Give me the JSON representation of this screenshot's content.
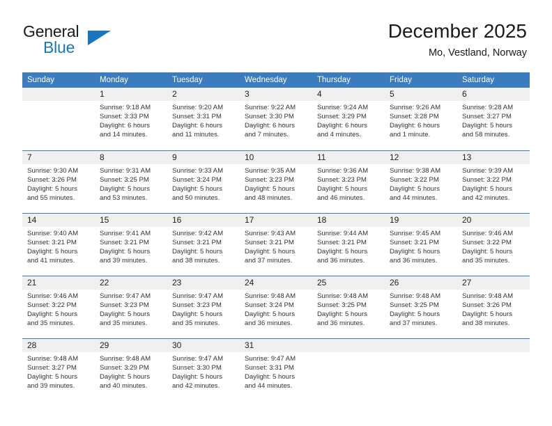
{
  "brand": {
    "name_top": "General",
    "name_bottom": "Blue",
    "triangle_color": "#1b75bb"
  },
  "header": {
    "title": "December 2025",
    "subtitle": "Mo, Vestland, Norway"
  },
  "theme": {
    "header_blue": "#3a7cbe",
    "daynum_band": "#f0f0f0",
    "text": "#333333"
  },
  "weekday_headers": [
    "Sunday",
    "Monday",
    "Tuesday",
    "Wednesday",
    "Thursday",
    "Friday",
    "Saturday"
  ],
  "weeks": [
    [
      {
        "day": "",
        "sunrise": "",
        "sunset": "",
        "daylight_line1": "",
        "daylight_line2": "",
        "empty": true
      },
      {
        "day": "1",
        "sunrise": "Sunrise: 9:18 AM",
        "sunset": "Sunset: 3:33 PM",
        "daylight_line1": "Daylight: 6 hours",
        "daylight_line2": "and 14 minutes."
      },
      {
        "day": "2",
        "sunrise": "Sunrise: 9:20 AM",
        "sunset": "Sunset: 3:31 PM",
        "daylight_line1": "Daylight: 6 hours",
        "daylight_line2": "and 11 minutes."
      },
      {
        "day": "3",
        "sunrise": "Sunrise: 9:22 AM",
        "sunset": "Sunset: 3:30 PM",
        "daylight_line1": "Daylight: 6 hours",
        "daylight_line2": "and 7 minutes."
      },
      {
        "day": "4",
        "sunrise": "Sunrise: 9:24 AM",
        "sunset": "Sunset: 3:29 PM",
        "daylight_line1": "Daylight: 6 hours",
        "daylight_line2": "and 4 minutes."
      },
      {
        "day": "5",
        "sunrise": "Sunrise: 9:26 AM",
        "sunset": "Sunset: 3:28 PM",
        "daylight_line1": "Daylight: 6 hours",
        "daylight_line2": "and 1 minute."
      },
      {
        "day": "6",
        "sunrise": "Sunrise: 9:28 AM",
        "sunset": "Sunset: 3:27 PM",
        "daylight_line1": "Daylight: 5 hours",
        "daylight_line2": "and 58 minutes."
      }
    ],
    [
      {
        "day": "7",
        "sunrise": "Sunrise: 9:30 AM",
        "sunset": "Sunset: 3:26 PM",
        "daylight_line1": "Daylight: 5 hours",
        "daylight_line2": "and 55 minutes."
      },
      {
        "day": "8",
        "sunrise": "Sunrise: 9:31 AM",
        "sunset": "Sunset: 3:25 PM",
        "daylight_line1": "Daylight: 5 hours",
        "daylight_line2": "and 53 minutes."
      },
      {
        "day": "9",
        "sunrise": "Sunrise: 9:33 AM",
        "sunset": "Sunset: 3:24 PM",
        "daylight_line1": "Daylight: 5 hours",
        "daylight_line2": "and 50 minutes."
      },
      {
        "day": "10",
        "sunrise": "Sunrise: 9:35 AM",
        "sunset": "Sunset: 3:23 PM",
        "daylight_line1": "Daylight: 5 hours",
        "daylight_line2": "and 48 minutes."
      },
      {
        "day": "11",
        "sunrise": "Sunrise: 9:36 AM",
        "sunset": "Sunset: 3:23 PM",
        "daylight_line1": "Daylight: 5 hours",
        "daylight_line2": "and 46 minutes."
      },
      {
        "day": "12",
        "sunrise": "Sunrise: 9:38 AM",
        "sunset": "Sunset: 3:22 PM",
        "daylight_line1": "Daylight: 5 hours",
        "daylight_line2": "and 44 minutes."
      },
      {
        "day": "13",
        "sunrise": "Sunrise: 9:39 AM",
        "sunset": "Sunset: 3:22 PM",
        "daylight_line1": "Daylight: 5 hours",
        "daylight_line2": "and 42 minutes."
      }
    ],
    [
      {
        "day": "14",
        "sunrise": "Sunrise: 9:40 AM",
        "sunset": "Sunset: 3:21 PM",
        "daylight_line1": "Daylight: 5 hours",
        "daylight_line2": "and 41 minutes."
      },
      {
        "day": "15",
        "sunrise": "Sunrise: 9:41 AM",
        "sunset": "Sunset: 3:21 PM",
        "daylight_line1": "Daylight: 5 hours",
        "daylight_line2": "and 39 minutes."
      },
      {
        "day": "16",
        "sunrise": "Sunrise: 9:42 AM",
        "sunset": "Sunset: 3:21 PM",
        "daylight_line1": "Daylight: 5 hours",
        "daylight_line2": "and 38 minutes."
      },
      {
        "day": "17",
        "sunrise": "Sunrise: 9:43 AM",
        "sunset": "Sunset: 3:21 PM",
        "daylight_line1": "Daylight: 5 hours",
        "daylight_line2": "and 37 minutes."
      },
      {
        "day": "18",
        "sunrise": "Sunrise: 9:44 AM",
        "sunset": "Sunset: 3:21 PM",
        "daylight_line1": "Daylight: 5 hours",
        "daylight_line2": "and 36 minutes."
      },
      {
        "day": "19",
        "sunrise": "Sunrise: 9:45 AM",
        "sunset": "Sunset: 3:21 PM",
        "daylight_line1": "Daylight: 5 hours",
        "daylight_line2": "and 36 minutes."
      },
      {
        "day": "20",
        "sunrise": "Sunrise: 9:46 AM",
        "sunset": "Sunset: 3:22 PM",
        "daylight_line1": "Daylight: 5 hours",
        "daylight_line2": "and 35 minutes."
      }
    ],
    [
      {
        "day": "21",
        "sunrise": "Sunrise: 9:46 AM",
        "sunset": "Sunset: 3:22 PM",
        "daylight_line1": "Daylight: 5 hours",
        "daylight_line2": "and 35 minutes."
      },
      {
        "day": "22",
        "sunrise": "Sunrise: 9:47 AM",
        "sunset": "Sunset: 3:23 PM",
        "daylight_line1": "Daylight: 5 hours",
        "daylight_line2": "and 35 minutes."
      },
      {
        "day": "23",
        "sunrise": "Sunrise: 9:47 AM",
        "sunset": "Sunset: 3:23 PM",
        "daylight_line1": "Daylight: 5 hours",
        "daylight_line2": "and 35 minutes."
      },
      {
        "day": "24",
        "sunrise": "Sunrise: 9:48 AM",
        "sunset": "Sunset: 3:24 PM",
        "daylight_line1": "Daylight: 5 hours",
        "daylight_line2": "and 36 minutes."
      },
      {
        "day": "25",
        "sunrise": "Sunrise: 9:48 AM",
        "sunset": "Sunset: 3:25 PM",
        "daylight_line1": "Daylight: 5 hours",
        "daylight_line2": "and 36 minutes."
      },
      {
        "day": "26",
        "sunrise": "Sunrise: 9:48 AM",
        "sunset": "Sunset: 3:25 PM",
        "daylight_line1": "Daylight: 5 hours",
        "daylight_line2": "and 37 minutes."
      },
      {
        "day": "27",
        "sunrise": "Sunrise: 9:48 AM",
        "sunset": "Sunset: 3:26 PM",
        "daylight_line1": "Daylight: 5 hours",
        "daylight_line2": "and 38 minutes."
      }
    ],
    [
      {
        "day": "28",
        "sunrise": "Sunrise: 9:48 AM",
        "sunset": "Sunset: 3:27 PM",
        "daylight_line1": "Daylight: 5 hours",
        "daylight_line2": "and 39 minutes."
      },
      {
        "day": "29",
        "sunrise": "Sunrise: 9:48 AM",
        "sunset": "Sunset: 3:29 PM",
        "daylight_line1": "Daylight: 5 hours",
        "daylight_line2": "and 40 minutes."
      },
      {
        "day": "30",
        "sunrise": "Sunrise: 9:47 AM",
        "sunset": "Sunset: 3:30 PM",
        "daylight_line1": "Daylight: 5 hours",
        "daylight_line2": "and 42 minutes."
      },
      {
        "day": "31",
        "sunrise": "Sunrise: 9:47 AM",
        "sunset": "Sunset: 3:31 PM",
        "daylight_line1": "Daylight: 5 hours",
        "daylight_line2": "and 44 minutes."
      },
      {
        "day": "",
        "sunrise": "",
        "sunset": "",
        "daylight_line1": "",
        "daylight_line2": "",
        "empty": true
      },
      {
        "day": "",
        "sunrise": "",
        "sunset": "",
        "daylight_line1": "",
        "daylight_line2": "",
        "empty": true
      },
      {
        "day": "",
        "sunrise": "",
        "sunset": "",
        "daylight_line1": "",
        "daylight_line2": "",
        "empty": true
      }
    ]
  ]
}
